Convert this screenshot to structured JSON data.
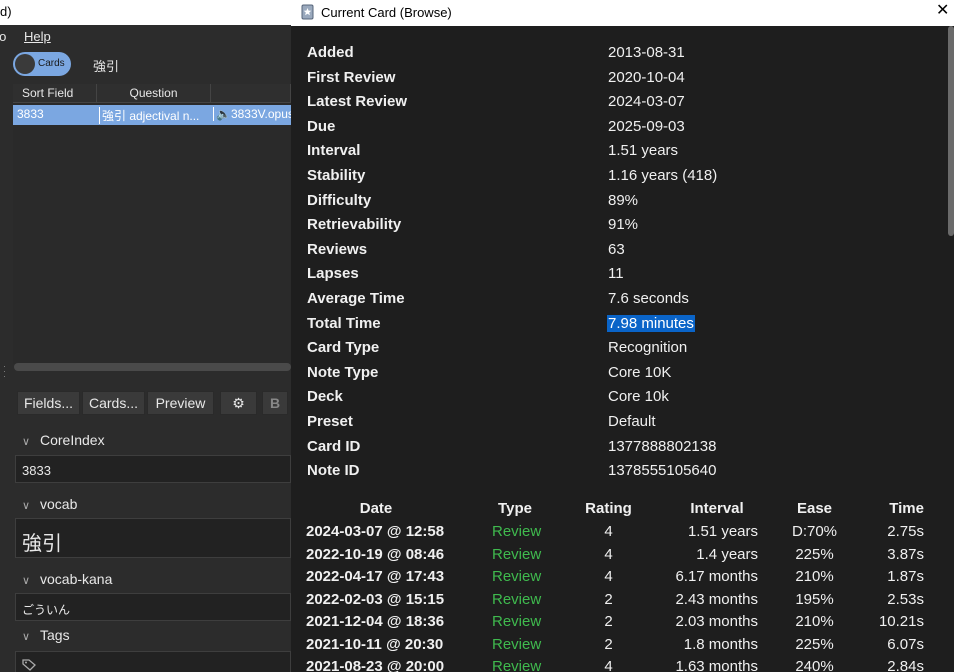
{
  "background": {
    "title_fragment": "d)",
    "menu": {
      "go": "Go",
      "help": "Help"
    },
    "toggle_label": "Cards",
    "search_text": "強引",
    "table": {
      "headers": [
        "Sort Field",
        "Question",
        ""
      ],
      "selected_row": {
        "sort_field": "3833",
        "question": "強引  adjectival n...",
        "audio": "3833V.opus"
      }
    },
    "editor_buttons": {
      "fields": "Fields...",
      "cards": "Cards...",
      "preview": "Preview",
      "bold": "B"
    },
    "fields": [
      {
        "label": "CoreIndex",
        "value": "3833"
      },
      {
        "label": "vocab",
        "value": "強引"
      },
      {
        "label": "vocab-kana",
        "value": "ごういん"
      },
      {
        "label": "Tags",
        "value": ""
      }
    ],
    "accent_color": "#7ba7e1"
  },
  "dialog": {
    "title": "Current Card (Browse)",
    "stats": [
      {
        "key": "Added",
        "value": "2013-08-31"
      },
      {
        "key": "First Review",
        "value": "2020-10-04"
      },
      {
        "key": "Latest Review",
        "value": "2024-03-07"
      },
      {
        "key": "Due",
        "value": "2025-09-03"
      },
      {
        "key": "Interval",
        "value": "1.51 years"
      },
      {
        "key": "Stability",
        "value": "1.16 years (418)"
      },
      {
        "key": "Difficulty",
        "value": "89%"
      },
      {
        "key": "Retrievability",
        "value": "91%"
      },
      {
        "key": "Reviews",
        "value": "63"
      },
      {
        "key": "Lapses",
        "value": "11"
      },
      {
        "key": "Average Time",
        "value": "7.6 seconds"
      },
      {
        "key": "Total Time",
        "value": "7.98 minutes"
      },
      {
        "key": "Card Type",
        "value": "Recognition"
      },
      {
        "key": "Note Type",
        "value": "Core 10K"
      },
      {
        "key": "Deck",
        "value": "Core 10k"
      },
      {
        "key": "Preset",
        "value": "Default"
      },
      {
        "key": "Card ID",
        "value": "1377888802138"
      },
      {
        "key": "Note ID",
        "value": "1378555105640"
      }
    ],
    "selected_stat": "Total Time",
    "revlog": {
      "headers": {
        "date": "Date",
        "type": "Type",
        "rating": "Rating",
        "interval": "Interval",
        "ease": "Ease",
        "time": "Time"
      },
      "rows": [
        {
          "date": "2024-03-07 @ 12:58",
          "type": "Review",
          "rating": "4",
          "interval": "1.51 years",
          "ease": "D:70%",
          "time": "2.75s"
        },
        {
          "date": "2022-10-19 @ 08:46",
          "type": "Review",
          "rating": "4",
          "interval": "1.4 years",
          "ease": "225%",
          "time": "3.87s"
        },
        {
          "date": "2022-04-17 @ 17:43",
          "type": "Review",
          "rating": "4",
          "interval": "6.17 months",
          "ease": "210%",
          "time": "1.87s"
        },
        {
          "date": "2022-02-03 @ 15:15",
          "type": "Review",
          "rating": "2",
          "interval": "2.43 months",
          "ease": "195%",
          "time": "2.53s"
        },
        {
          "date": "2021-12-04 @ 18:36",
          "type": "Review",
          "rating": "2",
          "interval": "2.03 months",
          "ease": "210%",
          "time": "10.21s"
        },
        {
          "date": "2021-10-11 @ 20:30",
          "type": "Review",
          "rating": "2",
          "interval": "1.8 months",
          "ease": "225%",
          "time": "6.07s"
        },
        {
          "date": "2021-08-23 @ 20:00",
          "type": "Review",
          "rating": "4",
          "interval": "1.63 months",
          "ease": "240%",
          "time": "2.84s"
        }
      ]
    },
    "colors": {
      "review_type": "#3fba4e",
      "selection": "#0a64c8"
    }
  }
}
